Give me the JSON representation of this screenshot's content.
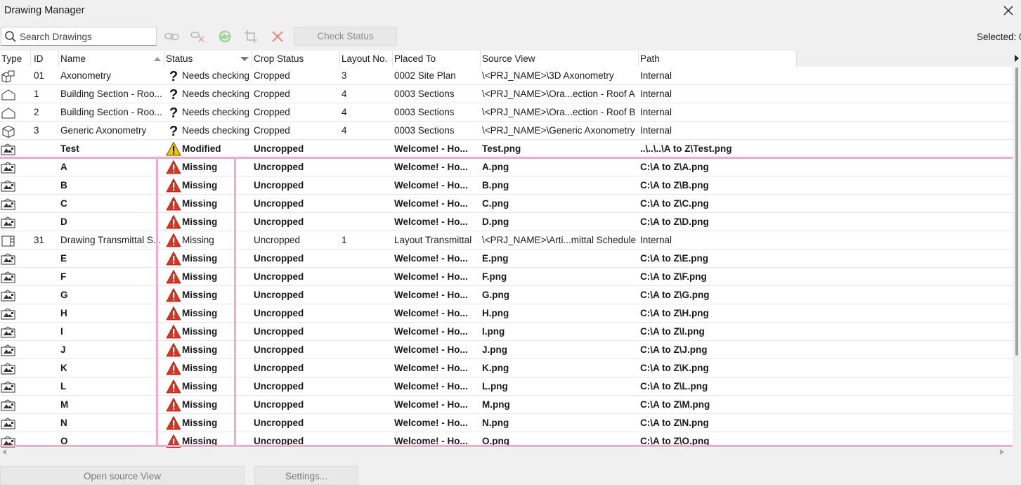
{
  "window": {
    "title": "Drawing Manager"
  },
  "toolbar": {
    "search_placeholder": "Search Drawings",
    "check_status_label": "Check Status",
    "selected_label": "Selected: 0"
  },
  "columns": {
    "type": "Type",
    "id": "ID",
    "name": "Name",
    "status": "Status",
    "crop": "Crop Status",
    "layout": "Layout No.",
    "placed": "Placed To",
    "source": "Source View",
    "path": "Path"
  },
  "rows": [
    {
      "type_icon": "axonometry-icon",
      "id": "01",
      "name": "Axonometry",
      "status": "Needs checking",
      "status_icon": "question-icon",
      "crop": "Cropped",
      "layout": "3",
      "placed": "0002 Site Plan",
      "source": "\\<PRJ_NAME>\\3D Axonometry",
      "path": "Internal",
      "bold": false
    },
    {
      "type_icon": "section-icon",
      "id": "1",
      "name": "Building Section - Roo...",
      "status": "Needs checking",
      "status_icon": "question-icon",
      "crop": "Cropped",
      "layout": "4",
      "placed": "0003 Sections",
      "source": "\\<PRJ_NAME>\\Ora...ection - Roof A",
      "path": "Internal",
      "bold": false
    },
    {
      "type_icon": "section-icon",
      "id": "2",
      "name": "Building Section - Roo...",
      "status": "Needs checking",
      "status_icon": "question-icon",
      "crop": "Cropped",
      "layout": "4",
      "placed": "0003 Sections",
      "source": "\\<PRJ_NAME>\\Ora...ection - Roof B",
      "path": "Internal",
      "bold": false
    },
    {
      "type_icon": "cube-icon",
      "id": "3",
      "name": "Generic Axonometry",
      "status": "Needs checking",
      "status_icon": "question-icon",
      "crop": "Cropped",
      "layout": "4",
      "placed": "0003 Sections",
      "source": "\\<PRJ_NAME>\\Generic Axonometry",
      "path": "Internal",
      "bold": false
    },
    {
      "type_icon": "image-icon",
      "id": "",
      "name": "Test",
      "status": "Modified",
      "status_icon": "warning-yellow-icon",
      "crop": "Uncropped",
      "layout": "",
      "placed": "Welcome! - Ho...",
      "source": "Test.png",
      "path": "..\\..\\..\\A to Z\\Test.png",
      "bold": true
    },
    {
      "type_icon": "image-icon",
      "id": "",
      "name": "A",
      "status": "Missing",
      "status_icon": "warning-red-icon",
      "crop": "Uncropped",
      "layout": "",
      "placed": "Welcome! - Ho...",
      "source": "A.png",
      "path": "C:\\A to Z\\A.png",
      "bold": true
    },
    {
      "type_icon": "image-icon",
      "id": "",
      "name": "B",
      "status": "Missing",
      "status_icon": "warning-red-icon",
      "crop": "Uncropped",
      "layout": "",
      "placed": "Welcome! - Ho...",
      "source": "B.png",
      "path": "C:\\A to Z\\B.png",
      "bold": true
    },
    {
      "type_icon": "image-icon",
      "id": "",
      "name": "C",
      "status": "Missing",
      "status_icon": "warning-red-icon",
      "crop": "Uncropped",
      "layout": "",
      "placed": "Welcome! - Ho...",
      "source": "C.png",
      "path": "C:\\A to Z\\C.png",
      "bold": true
    },
    {
      "type_icon": "image-icon",
      "id": "",
      "name": "D",
      "status": "Missing",
      "status_icon": "warning-red-icon",
      "crop": "Uncropped",
      "layout": "",
      "placed": "Welcome! - Ho...",
      "source": "D.png",
      "path": "C:\\A to Z\\D.png",
      "bold": true
    },
    {
      "type_icon": "schedule-icon",
      "id": "31",
      "name": "Drawing Transmittal S...",
      "status": "Missing",
      "status_icon": "warning-red-icon",
      "crop": "Uncropped",
      "layout": "1",
      "placed": "Layout Transmittal",
      "source": "\\<PRJ_NAME>\\Arti...mittal Schedule",
      "path": "Internal",
      "bold": false
    },
    {
      "type_icon": "image-icon",
      "id": "",
      "name": "E",
      "status": "Missing",
      "status_icon": "warning-red-icon",
      "crop": "Uncropped",
      "layout": "",
      "placed": "Welcome! - Ho...",
      "source": "E.png",
      "path": "C:\\A to Z\\E.png",
      "bold": true
    },
    {
      "type_icon": "image-icon",
      "id": "",
      "name": "F",
      "status": "Missing",
      "status_icon": "warning-red-icon",
      "crop": "Uncropped",
      "layout": "",
      "placed": "Welcome! - Ho...",
      "source": "F.png",
      "path": "C:\\A to Z\\F.png",
      "bold": true
    },
    {
      "type_icon": "image-icon",
      "id": "",
      "name": "G",
      "status": "Missing",
      "status_icon": "warning-red-icon",
      "crop": "Uncropped",
      "layout": "",
      "placed": "Welcome! - Ho...",
      "source": "G.png",
      "path": "C:\\A to Z\\G.png",
      "bold": true
    },
    {
      "type_icon": "image-icon",
      "id": "",
      "name": "H",
      "status": "Missing",
      "status_icon": "warning-red-icon",
      "crop": "Uncropped",
      "layout": "",
      "placed": "Welcome! - Ho...",
      "source": "H.png",
      "path": "C:\\A to Z\\H.png",
      "bold": true
    },
    {
      "type_icon": "image-icon",
      "id": "",
      "name": "I",
      "status": "Missing",
      "status_icon": "warning-red-icon",
      "crop": "Uncropped",
      "layout": "",
      "placed": "Welcome! - Ho...",
      "source": "I.png",
      "path": "C:\\A to Z\\I.png",
      "bold": true
    },
    {
      "type_icon": "image-icon",
      "id": "",
      "name": "J",
      "status": "Missing",
      "status_icon": "warning-red-icon",
      "crop": "Uncropped",
      "layout": "",
      "placed": "Welcome! - Ho...",
      "source": "J.png",
      "path": "C:\\A to Z\\J.png",
      "bold": true
    },
    {
      "type_icon": "image-icon",
      "id": "",
      "name": "K",
      "status": "Missing",
      "status_icon": "warning-red-icon",
      "crop": "Uncropped",
      "layout": "",
      "placed": "Welcome! - Ho...",
      "source": "K.png",
      "path": "C:\\A to Z\\K.png",
      "bold": true
    },
    {
      "type_icon": "image-icon",
      "id": "",
      "name": "L",
      "status": "Missing",
      "status_icon": "warning-red-icon",
      "crop": "Uncropped",
      "layout": "",
      "placed": "Welcome! - Ho...",
      "source": "L.png",
      "path": "C:\\A to Z\\L.png",
      "bold": true
    },
    {
      "type_icon": "image-icon",
      "id": "",
      "name": "M",
      "status": "Missing",
      "status_icon": "warning-red-icon",
      "crop": "Uncropped",
      "layout": "",
      "placed": "Welcome! - Ho...",
      "source": "M.png",
      "path": "C:\\A to Z\\M.png",
      "bold": true
    },
    {
      "type_icon": "image-icon",
      "id": "",
      "name": "N",
      "status": "Missing",
      "status_icon": "warning-red-icon",
      "crop": "Uncropped",
      "layout": "",
      "placed": "Welcome! - Ho...",
      "source": "N.png",
      "path": "C:\\A to Z\\N.png",
      "bold": true
    },
    {
      "type_icon": "image-icon",
      "id": "",
      "name": "O",
      "status": "Missing",
      "status_icon": "warning-red-icon",
      "crop": "Uncropped",
      "layout": "",
      "placed": "Welcome! - Ho...",
      "source": "O.png",
      "path": "C:\\A to Z\\O.png",
      "bold": true
    }
  ],
  "footer": {
    "open_source_label": "Open source View",
    "settings_label": "Settings..."
  },
  "colors": {
    "highlight": "#f6a9c8",
    "warning_red": "#e0321e",
    "warning_yellow": "#f5c400"
  }
}
